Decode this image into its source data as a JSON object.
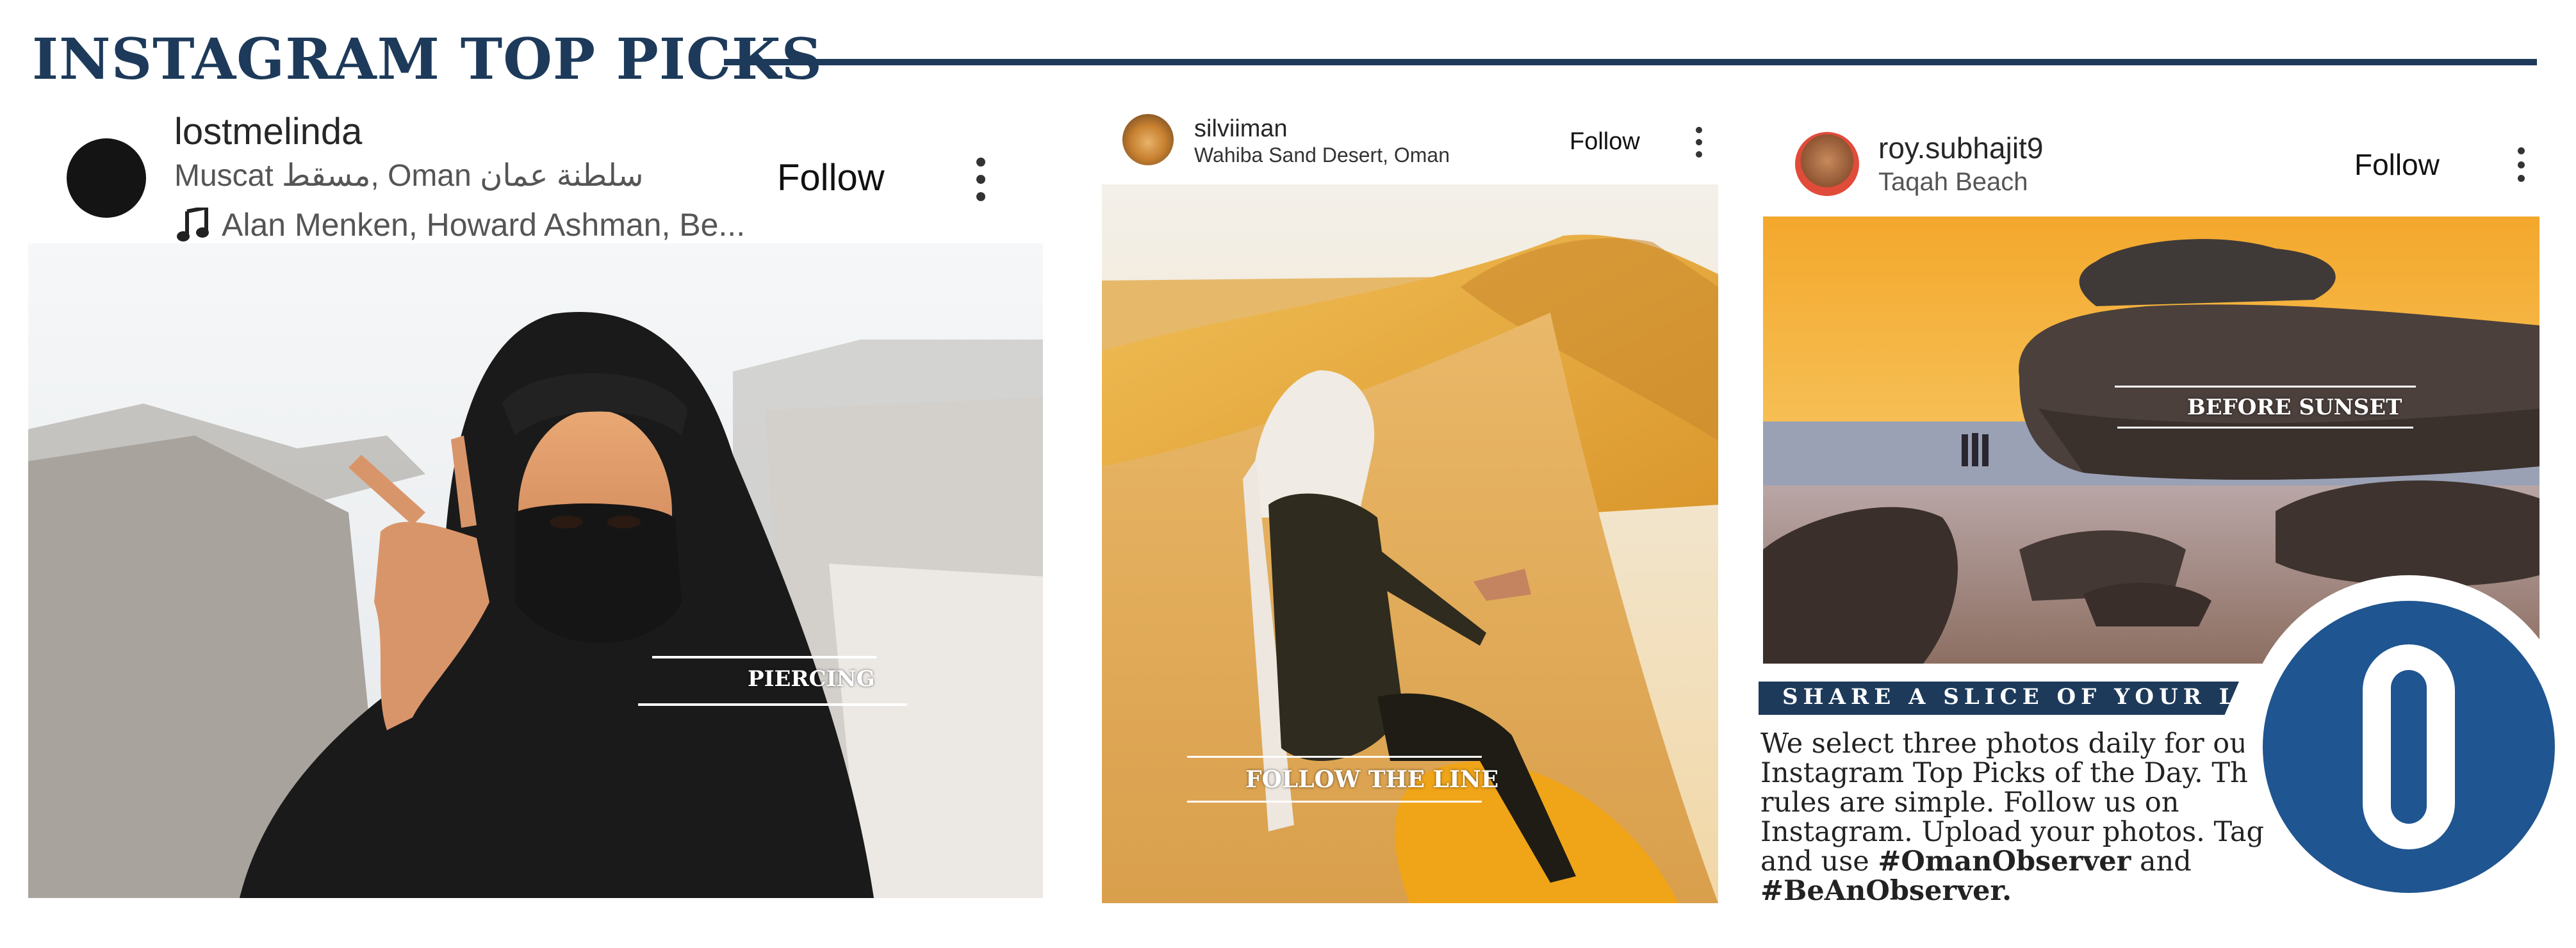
{
  "header": {
    "title": "INSTAGRAM TOP PICKS"
  },
  "colors": {
    "navy": "#1d3a5a",
    "logo_blue": "#1f5590",
    "text": "#222222"
  },
  "posts": [
    {
      "username": "lostmelinda",
      "location": "Muscat مسقط, Oman سلطنة عمان",
      "music": "Alan Menken, Howard Ashman, Be...",
      "music_icon": "music-note-icon",
      "follow_label": "Follow",
      "menu_icon": "more-vertical-icon",
      "caption": "PIERCING"
    },
    {
      "username": "silviiman",
      "location": "Wahiba Sand Desert, Oman",
      "follow_label": "Follow",
      "menu_icon": "more-vertical-icon",
      "caption": "FOLLOW THE LINE"
    },
    {
      "username": "roy.subhajit9",
      "location": "Taqah Beach",
      "follow_label": "Follow",
      "menu_icon": "more-vertical-icon",
      "caption": "BEFORE SUNSET"
    }
  ],
  "footer": {
    "banner": "SHARE A SLICE OF YOUR LIFE",
    "blurb_plain": "We select three photos daily for our Instagram Top Picks of the Day. The rules are simple. Follow us on Instagram. Upload your photos. Tag us and use",
    "hashtag_1": "#OmanObserver",
    "and_word": "and",
    "hashtag_2": "#BeAnObserver.",
    "logo_letter": "O"
  }
}
